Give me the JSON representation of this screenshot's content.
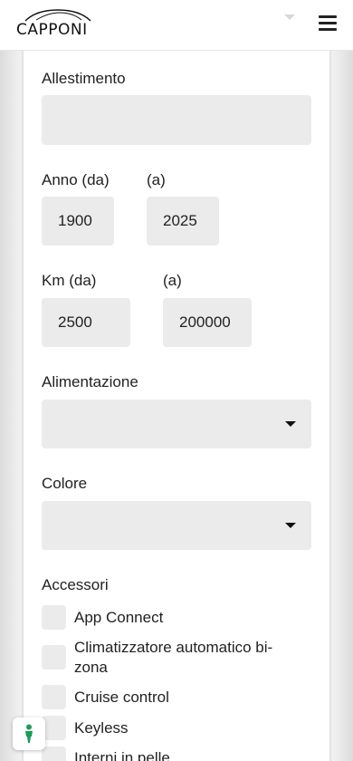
{
  "header": {
    "logo_text": "CAPPONI",
    "menu_icon": "hamburger-menu-icon"
  },
  "form": {
    "allestimento": {
      "label": "Allestimento",
      "value": ""
    },
    "anno": {
      "label_from": "Anno (da)",
      "label_to": "(a)",
      "from": "1900",
      "to": "2025"
    },
    "km": {
      "label_from": "Km (da)",
      "label_to": "(a)",
      "from": "2500",
      "to": "200000"
    },
    "alimentazione": {
      "label": "Alimentazione",
      "value": ""
    },
    "colore": {
      "label": "Colore",
      "value": ""
    },
    "accessori": {
      "label": "Accessori",
      "items": [
        {
          "label": "App Connect",
          "checked": false
        },
        {
          "label": "Climatizzatore automatico bi-zona",
          "checked": false
        },
        {
          "label": "Cruise control",
          "checked": false
        },
        {
          "label": "Keyless",
          "checked": false
        },
        {
          "label": "Interni in pelle",
          "checked": false
        }
      ]
    }
  },
  "chat_widget": {
    "icon": "accessibility-icon",
    "color": "#1a9e55"
  }
}
